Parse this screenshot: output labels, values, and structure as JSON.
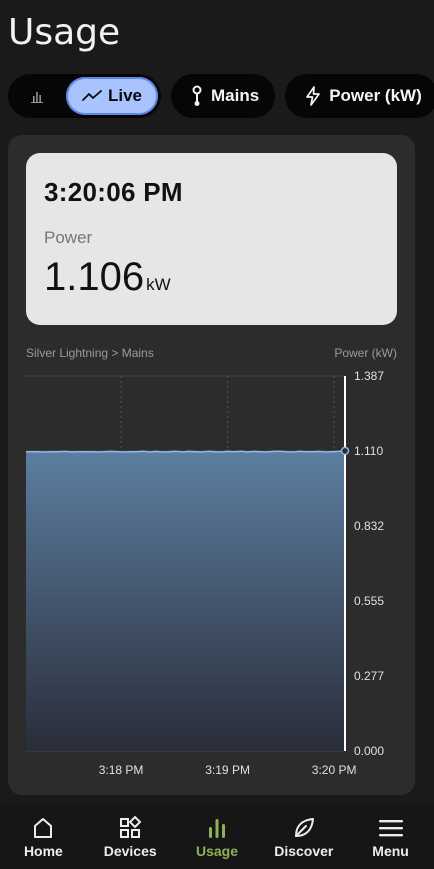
{
  "page": {
    "title": "Usage"
  },
  "filters": {
    "live_label": "Live",
    "mains_label": "Mains",
    "power_label": "Power (kW)"
  },
  "readout": {
    "time": "3:20:06 PM",
    "label": "Power",
    "value": "1.106",
    "unit": "kW"
  },
  "chart_header": {
    "source": "Silver Lightning > Mains",
    "metric": "Power (kW)"
  },
  "chart_data": {
    "type": "area",
    "ylim": [
      0,
      1.387
    ],
    "yticks": [
      "1.387",
      "1.110",
      "0.832",
      "0.555",
      "0.277",
      "0.000"
    ],
    "ytick_values": [
      1.387,
      1.11,
      0.832,
      0.555,
      0.277,
      0.0
    ],
    "xticks": [
      "3:18 PM",
      "3:19 PM",
      "3:20 PM"
    ],
    "xtick_values": [
      0.298,
      0.632,
      0.966
    ],
    "series": [
      {
        "values": [
          1.107,
          1.107,
          1.107,
          1.106,
          1.107,
          1.107,
          1.108,
          1.106,
          1.107,
          1.107,
          1.107,
          1.106,
          1.107,
          1.108,
          1.107,
          1.106,
          1.107,
          1.107,
          1.109,
          1.106,
          1.108,
          1.106,
          1.107,
          1.109,
          1.106,
          1.108,
          1.107,
          1.106,
          1.109,
          1.107,
          1.106,
          1.108,
          1.107,
          1.109,
          1.106,
          1.108,
          1.107,
          1.106,
          1.108,
          1.109,
          1.107,
          1.106,
          1.108,
          1.107,
          1.107,
          1.108,
          1.106,
          1.107,
          1.108,
          1.11
        ]
      }
    ],
    "colors": {
      "line": "#8fb8ee",
      "fill_top": "#5c7ea0",
      "fill_bottom": "#2a2d3a"
    }
  },
  "nav": {
    "items": [
      {
        "label": "Home",
        "icon": "home-icon"
      },
      {
        "label": "Devices",
        "icon": "devices-icon"
      },
      {
        "label": "Usage",
        "icon": "usage-bars-icon"
      },
      {
        "label": "Discover",
        "icon": "leaf-icon"
      },
      {
        "label": "Menu",
        "icon": "menu-icon"
      }
    ],
    "active_color": "#8fb15a"
  }
}
